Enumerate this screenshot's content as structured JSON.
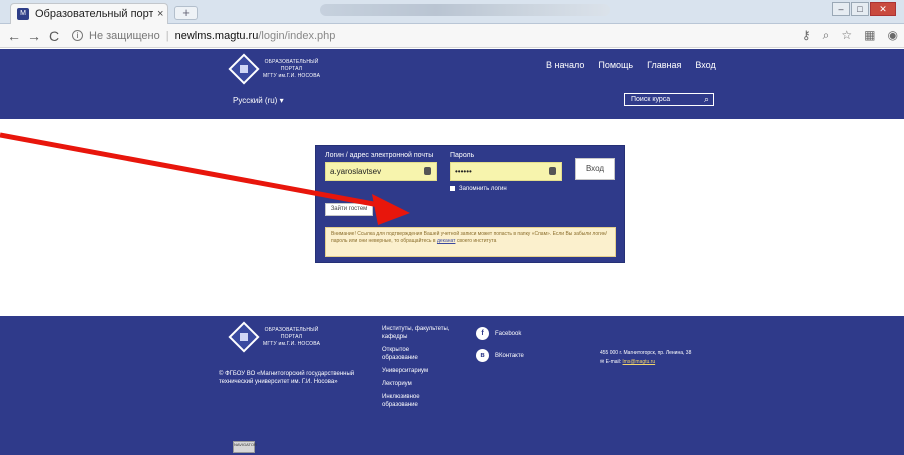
{
  "browser": {
    "tab_title": "Образовательный портал ФГБ",
    "tab_close": "×",
    "new_tab": "+",
    "not_secure": "Не защищено",
    "host": "newlms.magtu.ru",
    "path": "/login/index.php",
    "nav": {
      "back": "←",
      "forward": "→",
      "reload": "C"
    },
    "right_icons": [
      "key-icon",
      "zoom-icon",
      "star-icon",
      "extension-icon",
      "account-icon"
    ]
  },
  "header": {
    "logo_lines": [
      "ОБРАЗОВАТЕЛЬНЫЙ",
      "ПОРТАЛ",
      "МГТУ им.Г.И. НОСОВА"
    ],
    "nav": [
      "В начало",
      "Помощь",
      "Главная",
      "Вход"
    ],
    "language": "Русский (ru) ▾",
    "search_placeholder": "Поиск курса"
  },
  "login": {
    "username_label": "Логин / адрес электронной почты",
    "username_value": "a.yaroslavtsev",
    "password_label": "Пароль",
    "password_value": "••••••",
    "login_button": "Вход",
    "remember_label": "Запомнить логин",
    "guest_button": "Зайти гостем",
    "alert_text": "Внимание! Ссылка для подтверждения Вашей учетной записи может попасть в папку «Спам». Если Вы забыли логин/пароль или они неверные, то обращайтесь в",
    "alert_link": "деканат",
    "alert_tail": "своего института"
  },
  "footer": {
    "logo_lines": [
      "ОБРАЗОВАТЕЛЬНЫЙ",
      "ПОРТАЛ",
      "МГТУ им.Г.И. НОСОВА"
    ],
    "copyright_line1": "© ФГБОУ ВО «Магнитогорский государственный",
    "copyright_line2": "технический университет им. Г.И. Носова»",
    "links": [
      "Институты, факультеты, кафедры",
      "Открытое образование",
      "Университариум",
      "Лекториум",
      "Инклюзивное образование"
    ],
    "social": [
      "Facebook",
      "ВКонтакте"
    ],
    "address": "455 000 г. Магнитогорск, пр. Ленина, 38",
    "email_label": "E-mail:",
    "email": "lms@magtu.ru",
    "badge": "NAVIGATOR"
  },
  "colors": {
    "brand": "#2f3a8a",
    "arrow": "#e8160c",
    "field": "#f7f4ad"
  }
}
